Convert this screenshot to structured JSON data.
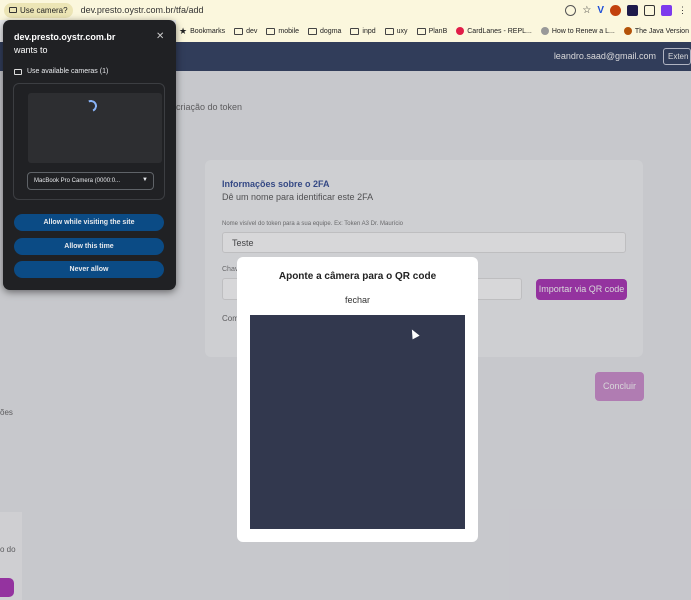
{
  "browser": {
    "camera_chip": "Use camera?",
    "url": "dev.presto.oystr.com.br/tfa/add",
    "bookmarks": [
      "Bookmarks",
      "dev",
      "mobile",
      "dogma",
      "inpd",
      "uxy",
      "PlanB",
      "CardLanes - REPL...",
      "How to Renew a L...",
      "The Java Version"
    ]
  },
  "header": {
    "user_email": "leandro.saad@gmail.com",
    "extra_button": "Exten"
  },
  "breadcrumb": "criação do token",
  "left_fragments": [
    "ões",
    "o do"
  ],
  "form": {
    "section_title": "Informações sobre o 2FA",
    "section_subtitle": "Dê um nome para identificar este 2FA",
    "name_label": "Nome visível do token para a sua equipe. Ex: Token A3 Dr. Maurício",
    "name_value": "Teste",
    "key_label": "Chav",
    "import_button": "Importar via QR code",
    "comp_label": "Com",
    "submit_button": "Concluir"
  },
  "qr_modal": {
    "title": "Aponte a câmera para o QR code",
    "close_label": "fechar"
  },
  "permission_popup": {
    "host": "dev.presto.oystr.com.br",
    "wants": "wants to",
    "camera_option": "Use available cameras (1)",
    "camera_select": "MacBook Pro Camera (0000:0...",
    "allow_visit": "Allow while visiting the site",
    "allow_once": "Allow this time",
    "never": "Never allow"
  },
  "colors": {
    "header_bg": "#1a2a4f",
    "accent_purple": "#a21caf",
    "popup_button": "#0b4b85"
  }
}
